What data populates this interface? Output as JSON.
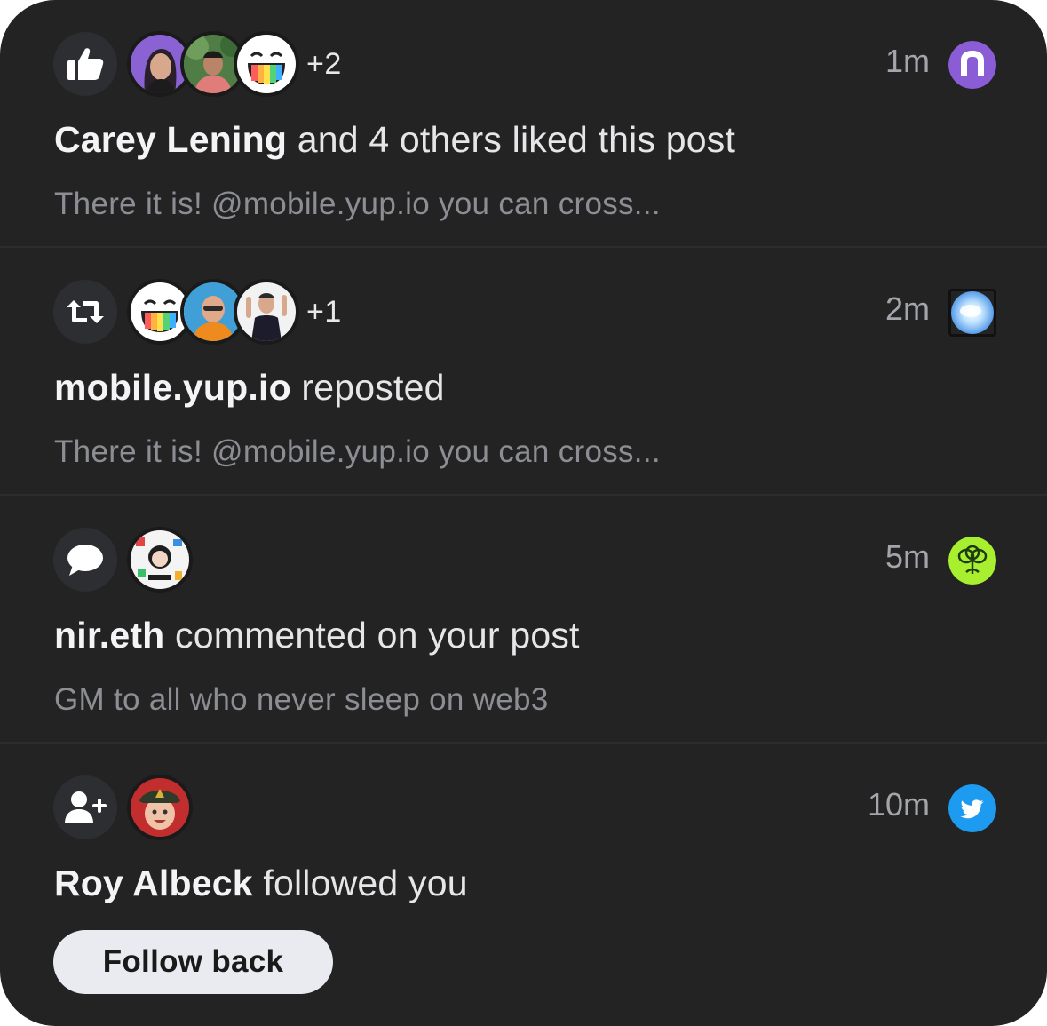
{
  "notifications": [
    {
      "action_icon": "thumbs-up-icon",
      "extra_count": "+2",
      "time": "1m",
      "platform_icon": "lens-protocol-icon",
      "actor": "Carey Lening",
      "action_text": " and 4 others liked this post",
      "preview": "There it is! @mobile.yup.io you can cross..."
    },
    {
      "action_icon": "repost-icon",
      "extra_count": "+1",
      "time": "2m",
      "platform_icon": "sky-icon",
      "actor": "mobile.yup.io",
      "action_text": " reposted",
      "preview": "There it is! @mobile.yup.io you can cross..."
    },
    {
      "action_icon": "comment-icon",
      "time": "5m",
      "platform_icon": "lens-sprout-icon",
      "actor": "nir.eth",
      "action_text": " commented on your post",
      "preview": "GM to all who never sleep on web3"
    },
    {
      "action_icon": "user-plus-icon",
      "time": "10m",
      "platform_icon": "twitter-icon",
      "actor": "Roy Albeck",
      "action_text": " followed you",
      "button_label": "Follow back"
    }
  ],
  "colors": {
    "panel_background": "#232323",
    "twitter_blue": "#1d9bf0",
    "lens_purple": "#8a5cd6",
    "lens_green": "#a8ef2f"
  }
}
